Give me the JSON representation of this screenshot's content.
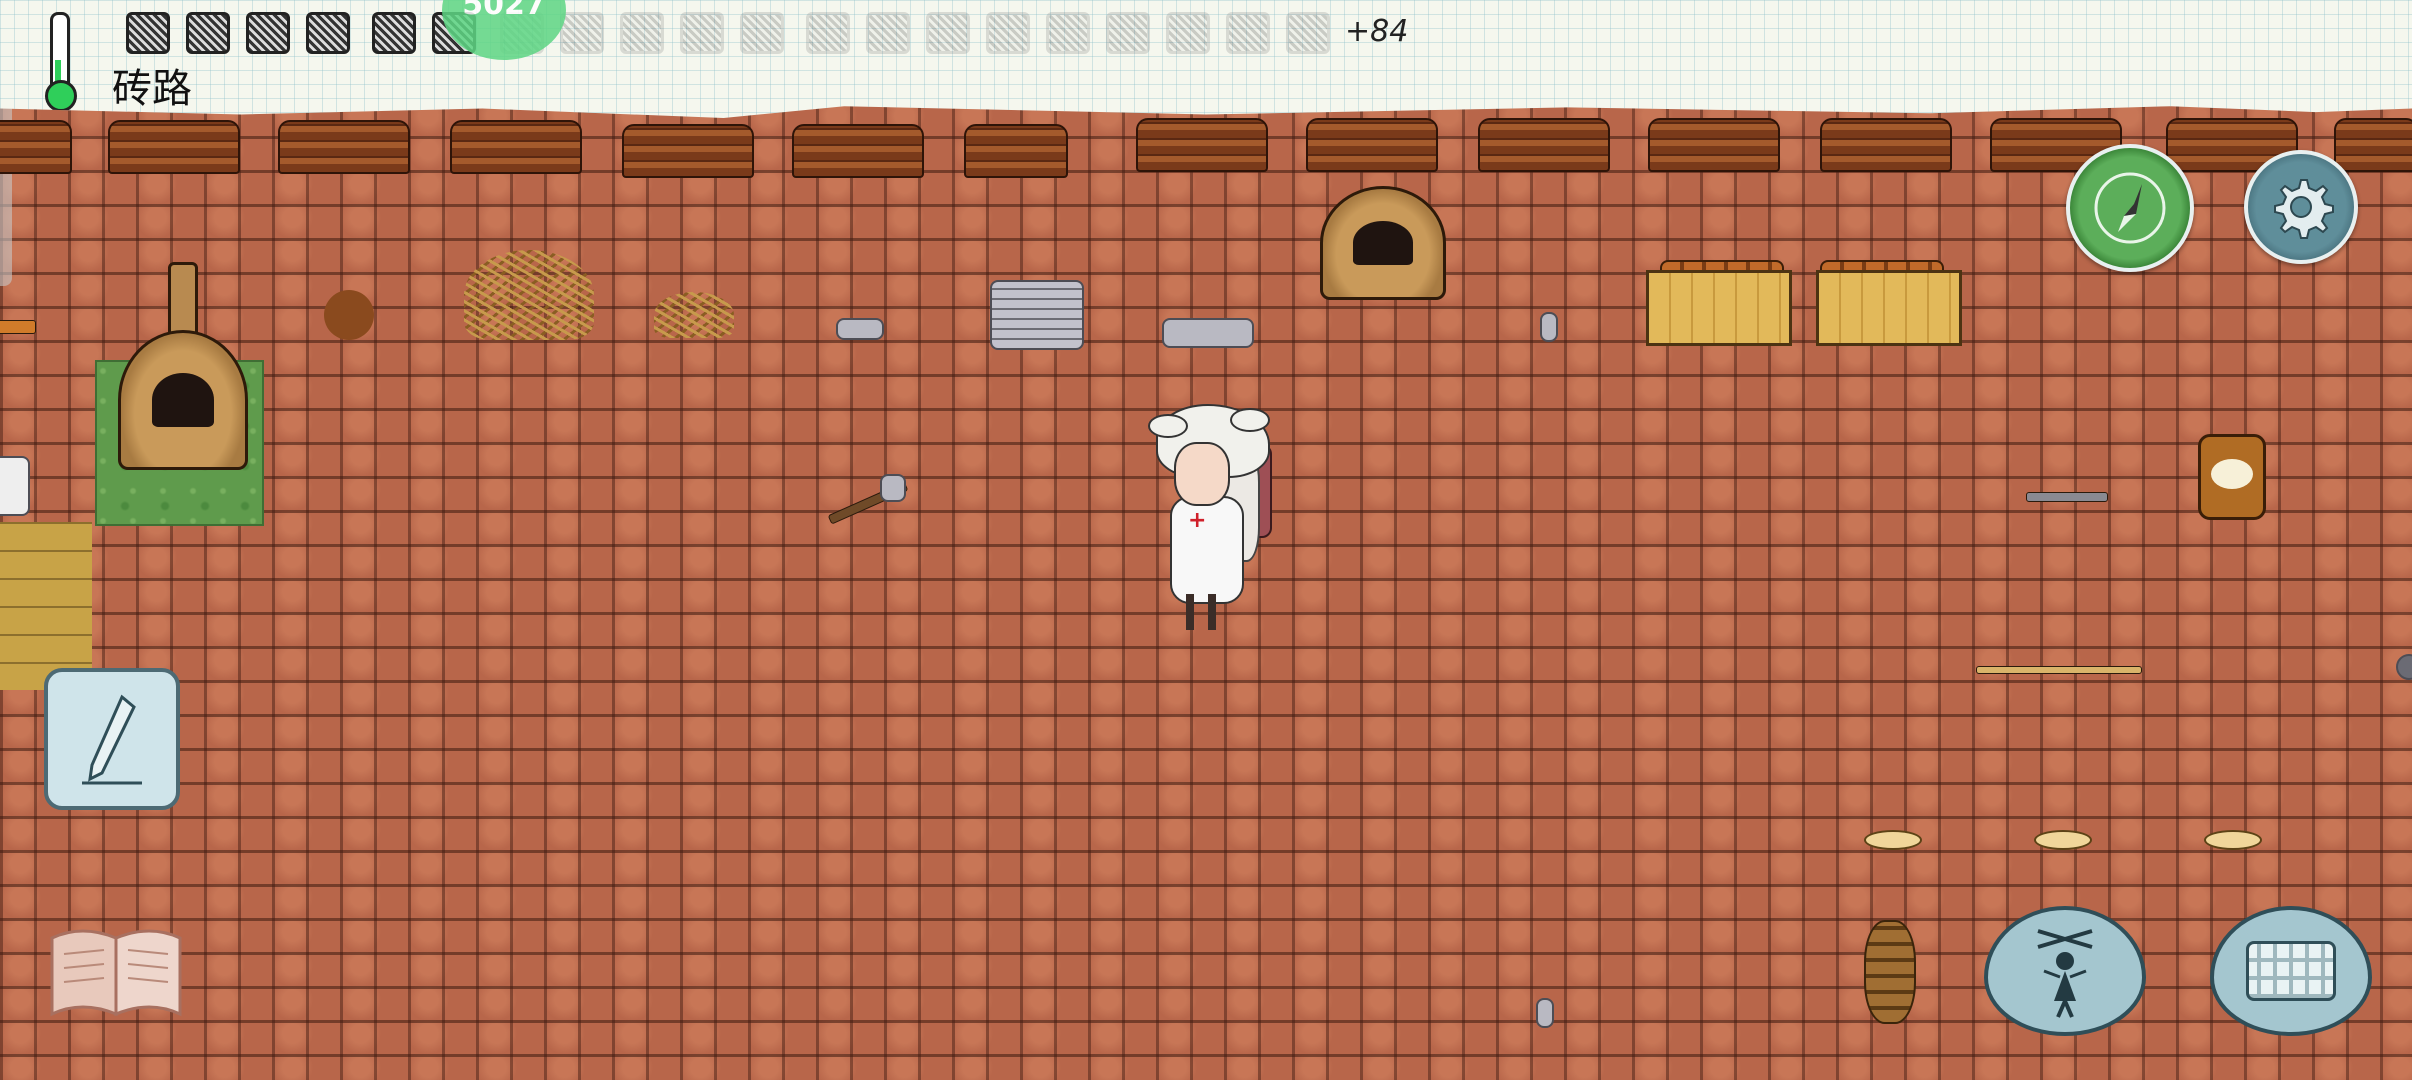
{
  "hud": {
    "biome_label": "砖路",
    "extra_food_count": "+84",
    "yum_value": "5027",
    "food_icons": [
      "food",
      "food",
      "food",
      "food",
      "food",
      "food",
      "food",
      "food",
      "food",
      "food",
      "food",
      "food",
      "food",
      "food",
      "food",
      "food",
      "food",
      "food",
      "food",
      "food",
      "food"
    ],
    "thermometer_color": "#2fcf5a"
  },
  "buttons": {
    "compass": "compass-icon",
    "settings": "gear-icon",
    "edit": "pencil-icon",
    "recipe_book": "book-icon",
    "puppet": "puppet-icon",
    "keyboard": "keyboard-icon"
  },
  "colors": {
    "brick": "#b8664a",
    "grass": "#5f9b4c",
    "path": "#c8a347",
    "paper": "#f5f7ee"
  }
}
